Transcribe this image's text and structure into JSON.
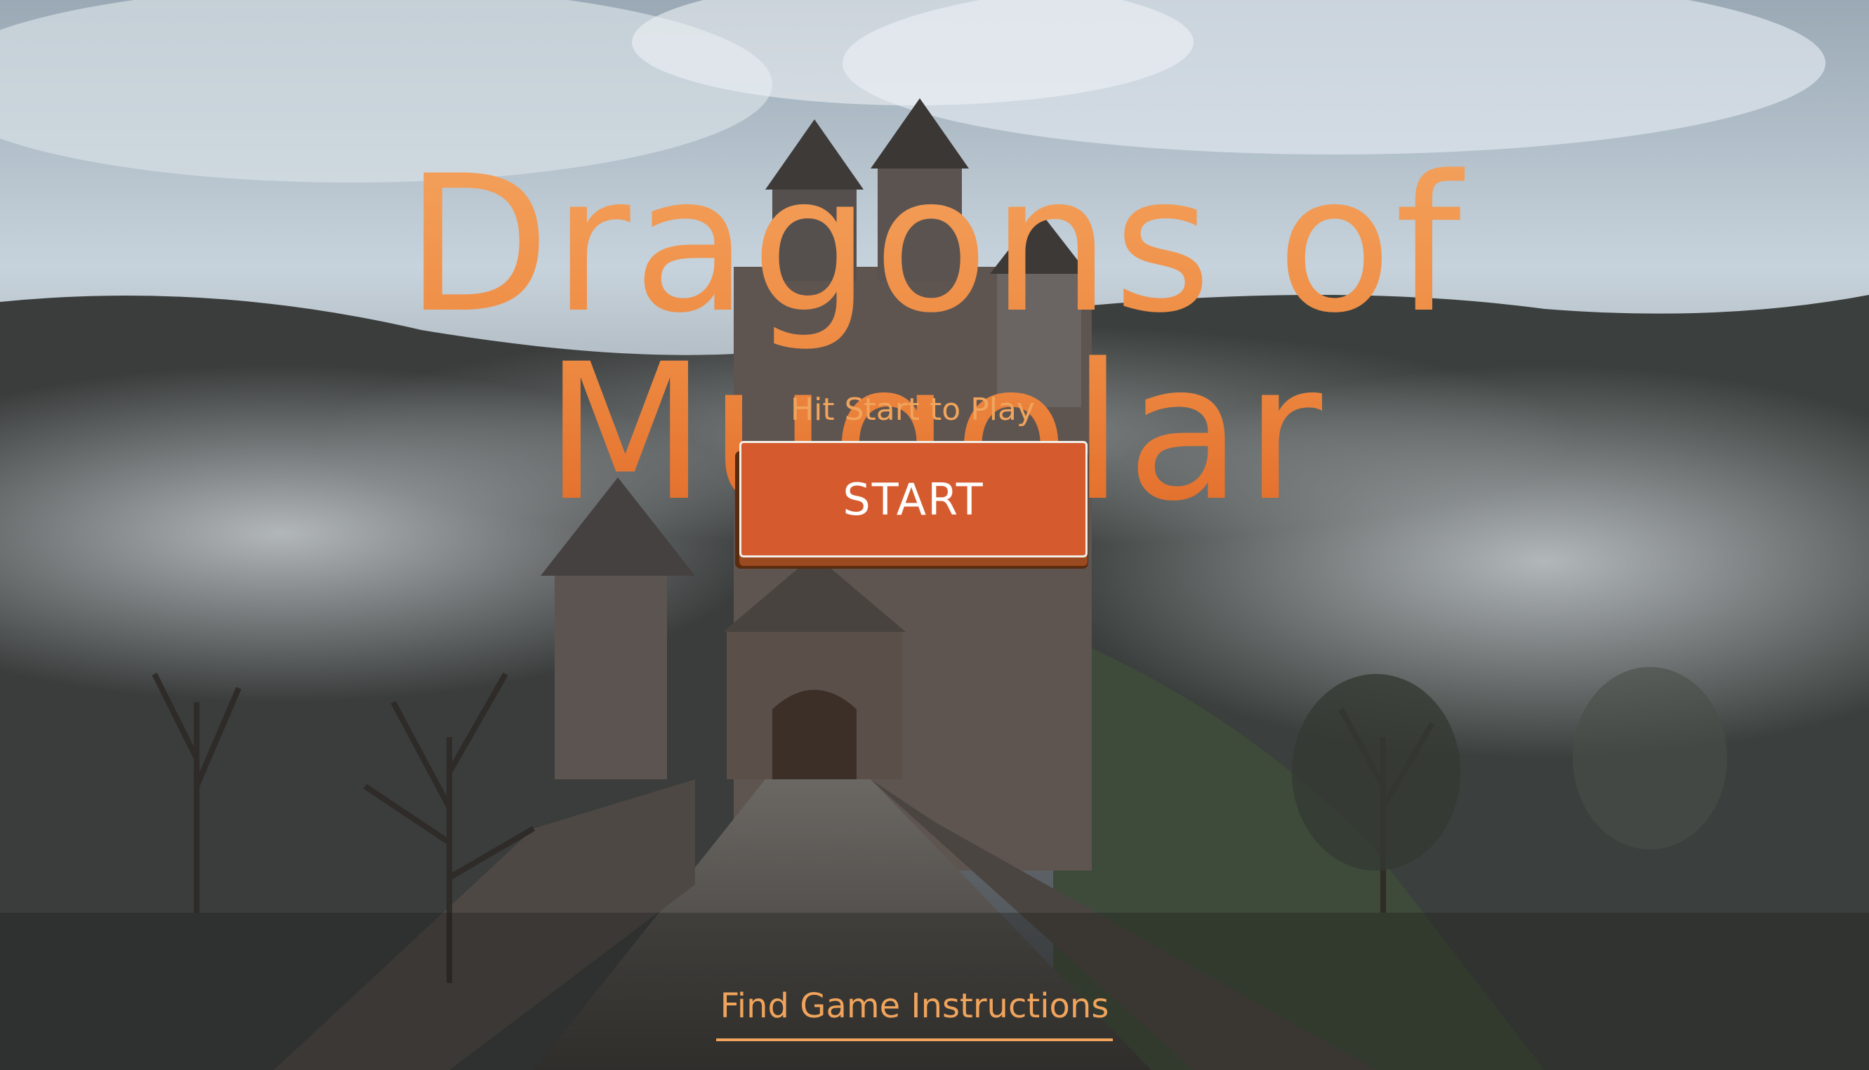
{
  "game": {
    "title": "Dragons of Mugolar",
    "subtitle": "Hit Start to Play",
    "start_label": "START",
    "instructions_link": "Find Game Instructions"
  },
  "colors": {
    "title_orange": "#ee8a42",
    "button_fill": "#d55b2f",
    "button_border": "#f2efe8",
    "link_orange": "#f0a45c"
  },
  "background": {
    "icon": "foggy-castle-background"
  }
}
